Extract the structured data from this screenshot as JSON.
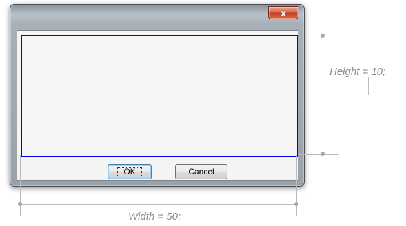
{
  "dialog": {
    "close_glyph": "x",
    "ok_label": "OK",
    "cancel_label": "Cancel"
  },
  "annotations": {
    "height_label": "Height = 10;",
    "width_label": "Width = 50;"
  },
  "colors": {
    "client_border": "#0000ff",
    "close_button": "#c13d22",
    "annotation_text": "#8b8b8b"
  }
}
